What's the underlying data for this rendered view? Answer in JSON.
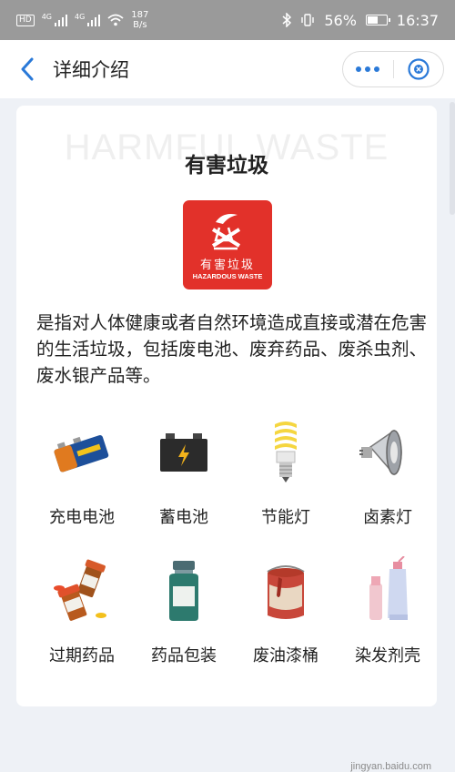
{
  "status_bar": {
    "hd_badge": "HD",
    "network_label_1": "4G",
    "network_label_2": "4G",
    "speed_value": "187",
    "speed_unit": "B/s",
    "battery_percent": "56%",
    "battery_level": 0.56,
    "time": "16:37"
  },
  "navbar": {
    "title": "详细介绍"
  },
  "card": {
    "watermark": "HARMFUL WASTE",
    "title": "有害垃圾",
    "logo": {
      "cn": "有害垃圾",
      "en": "HAZARDOUS WASTE",
      "color": "#e2312a"
    },
    "description": "是指对人体健康或者自然环境造成直接或潜在危害的生活垃圾，包括废电池、废弃药品、废杀虫剂、废水银产品等。",
    "items": [
      {
        "label": "充电电池",
        "icon": "rechargeable-battery-icon"
      },
      {
        "label": "蓄电池",
        "icon": "storage-battery-icon"
      },
      {
        "label": "节能灯",
        "icon": "energy-saving-lamp-icon"
      },
      {
        "label": "卤素灯",
        "icon": "halogen-lamp-icon"
      },
      {
        "label": "过期药品",
        "icon": "expired-medicine-icon"
      },
      {
        "label": "药品包装",
        "icon": "medicine-package-icon"
      },
      {
        "label": "废油漆桶",
        "icon": "paint-bucket-icon"
      },
      {
        "label": "染发剂壳",
        "icon": "hair-dye-tube-icon"
      }
    ]
  },
  "watermark_corner": "jingyan.baidu.com",
  "accent_color": "#2a79d8"
}
